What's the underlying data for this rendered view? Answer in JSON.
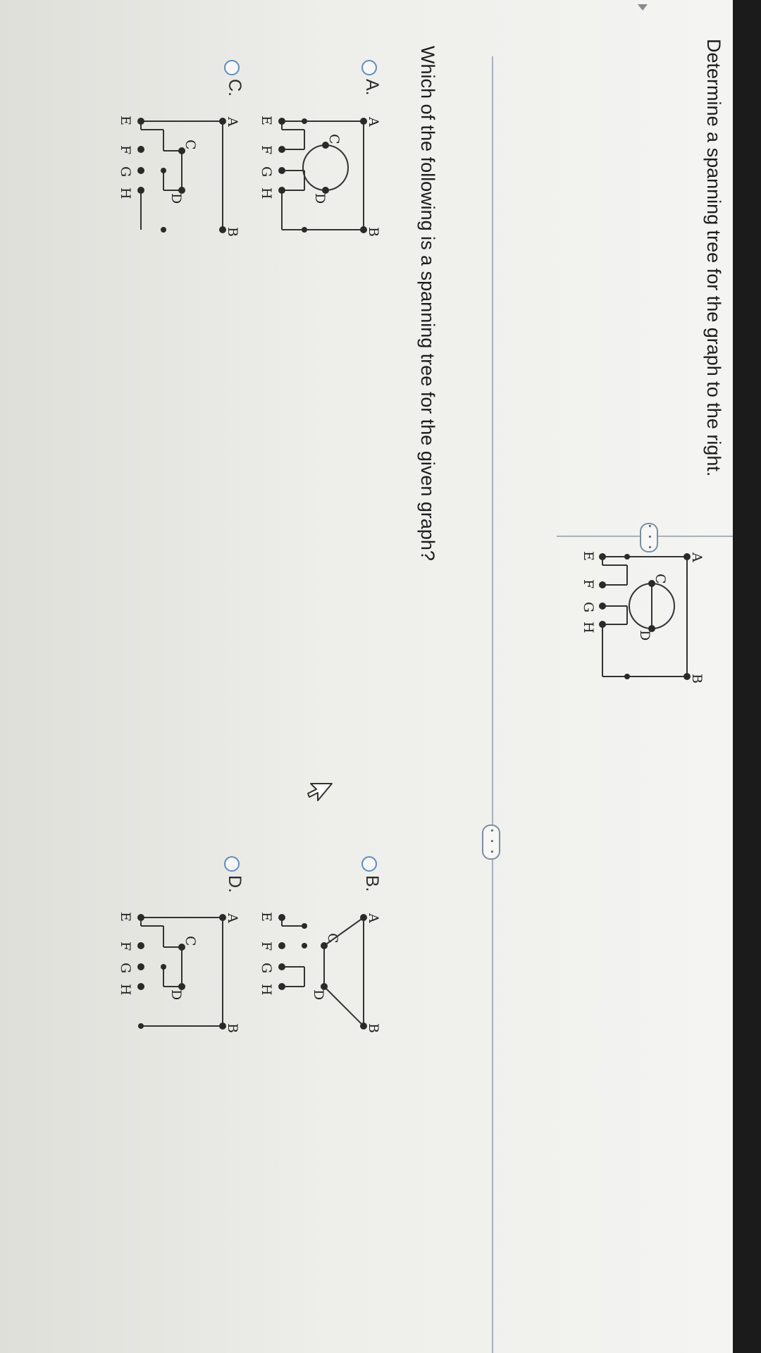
{
  "header": {
    "instruction": "Determine a spanning tree for the graph to the right."
  },
  "reference_graph": {
    "labels": [
      "A",
      "B",
      "C",
      "D",
      "E",
      "F",
      "G",
      "H"
    ]
  },
  "expand_buttons": {
    "top": "· · ·",
    "mid": "· · ·"
  },
  "question": {
    "prompt": "Which of the following is a spanning tree for the given graph?"
  },
  "options": [
    {
      "letter": "A.",
      "id": "a",
      "labels": [
        "A",
        "B",
        "C",
        "D",
        "E",
        "F",
        "G",
        "H"
      ]
    },
    {
      "letter": "B.",
      "id": "b",
      "labels": [
        "A",
        "B",
        "C",
        "D",
        "E",
        "F",
        "G",
        "H"
      ]
    },
    {
      "letter": "C.",
      "id": "c",
      "labels": [
        "A",
        "B",
        "C",
        "D",
        "E",
        "F",
        "G",
        "H"
      ]
    },
    {
      "letter": "D.",
      "id": "d",
      "labels": [
        "A",
        "B",
        "C",
        "D",
        "E",
        "F",
        "G",
        "H"
      ]
    }
  ],
  "icons": {
    "cursor": "mouse-pointer-icon",
    "radio": "radio-button-icon"
  }
}
